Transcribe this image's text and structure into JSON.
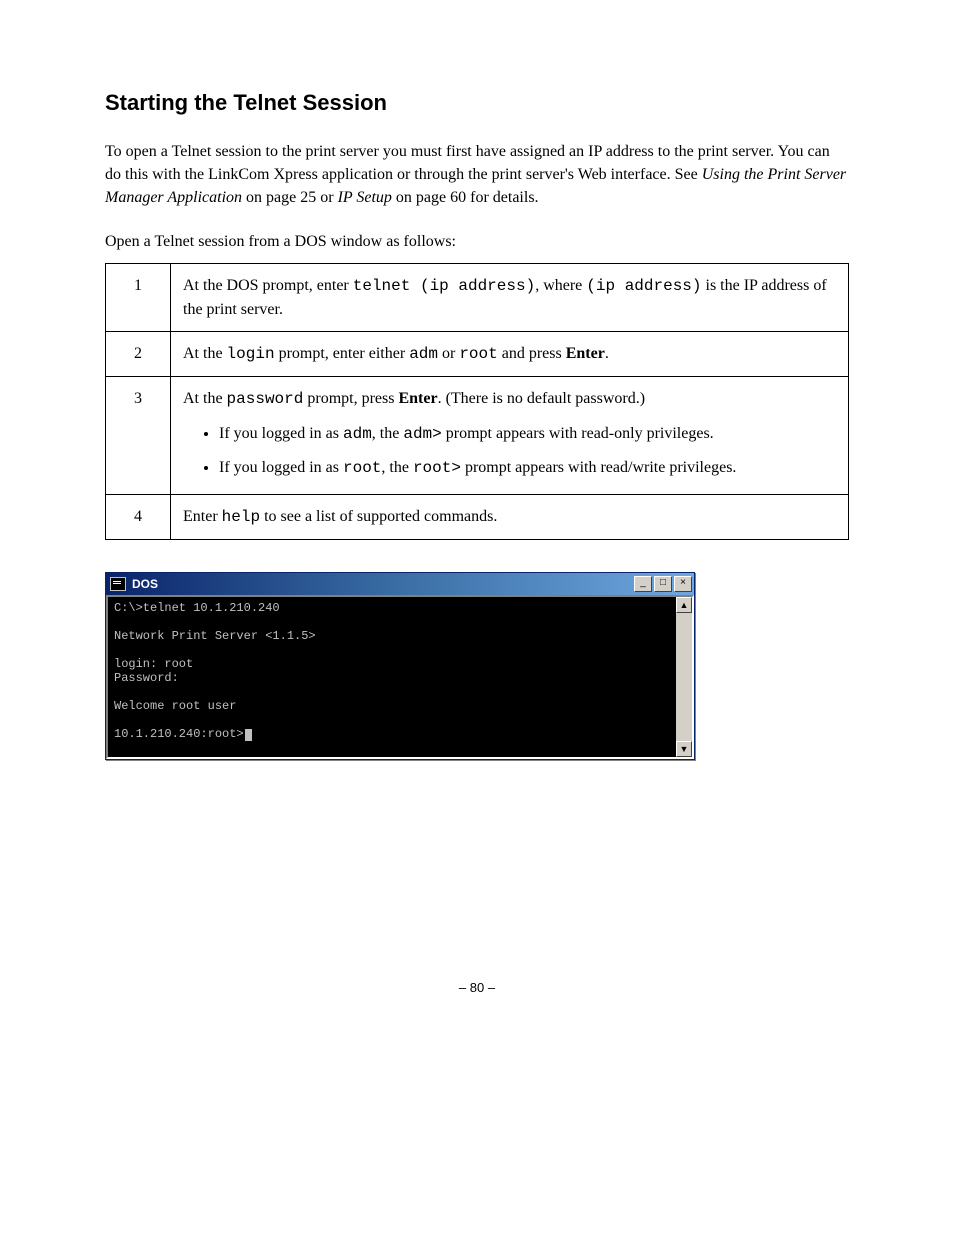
{
  "section_title": "Starting the Telnet Session",
  "intro_paragraph": "To open a Telnet session to the print server you must first have assigned an IP address to the print server. You can do this with the LinkCom Xpress application or through the print server's Web interface. See Using the Print Server Manager Application on page 25 or IP Setup on page 60 for details.",
  "open_session_intro": "Open a Telnet session from a DOS window as follows:",
  "steps": [
    {
      "num": "1",
      "content_plain": "At the DOS prompt, enter telnet (ip address), where (ip address) is the IP address of the print server."
    },
    {
      "num": "2",
      "content_plain": "At the login prompt, enter either adm or root and press Enter."
    },
    {
      "num": "3",
      "intro": "At the password prompt, press Enter. (There is no default password.)",
      "bullets": [
        "If you logged in as adm, the adm> prompt appears with read-only privileges.",
        "If you logged in as root, the root> prompt appears with read/write privileges."
      ]
    },
    {
      "num": "4",
      "content_plain": "Enter help to see a list of supported commands."
    }
  ],
  "dos_window": {
    "title": "DOS",
    "lines": [
      "C:\\>telnet 10.1.210.240",
      "",
      "Network Print Server <1.1.5>",
      "",
      "login: root",
      "Password:",
      "",
      "Welcome root user",
      "",
      "10.1.210.240:root>"
    ]
  },
  "page_number": "– 80 –",
  "icons": {
    "minimize": "_",
    "maximize": "□",
    "close": "×",
    "scroll_up": "▲",
    "scroll_down": "▼"
  }
}
